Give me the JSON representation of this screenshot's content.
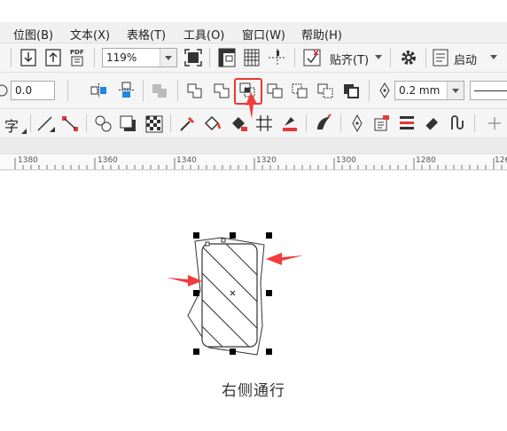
{
  "menu": {
    "items": [
      "位图(B)",
      "文本(X)",
      "表格(T)",
      "工具(O)",
      "窗口(W)",
      "帮助(H)"
    ]
  },
  "toolbar1": {
    "zoom_value": "119%",
    "snap_label": "贴齐(T)",
    "launch_label": "启动",
    "pdf_label": "PDF"
  },
  "toolbar2": {
    "rotation_value": "0.0",
    "outline_width_value": "0.2 mm"
  },
  "toolbar3": {
    "text_tool_glyph": "字"
  },
  "ruler": {
    "labels": [
      "1380",
      "1360",
      "1340",
      "1320",
      "1300",
      "1280",
      "126"
    ]
  },
  "canvas": {
    "caption": "右侧通行"
  },
  "colors": {
    "annotation_arrow": "#f03c3c",
    "highlight_box": "#e53935",
    "selection_handle": "#000000"
  }
}
